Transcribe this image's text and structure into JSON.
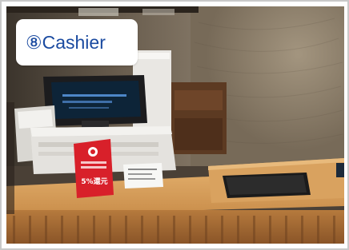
{
  "caption": {
    "label": "⑧Cashier"
  },
  "photo": {
    "subject": "cashier-counter-photo",
    "sign_text": "5%還元"
  },
  "colors": {
    "caption_text": "#1a4aa0",
    "caption_bg": "#ffffff",
    "frame_border": "#c9c9c9",
    "counter_wood": "#d49a55",
    "sign_red": "#d8202a"
  }
}
